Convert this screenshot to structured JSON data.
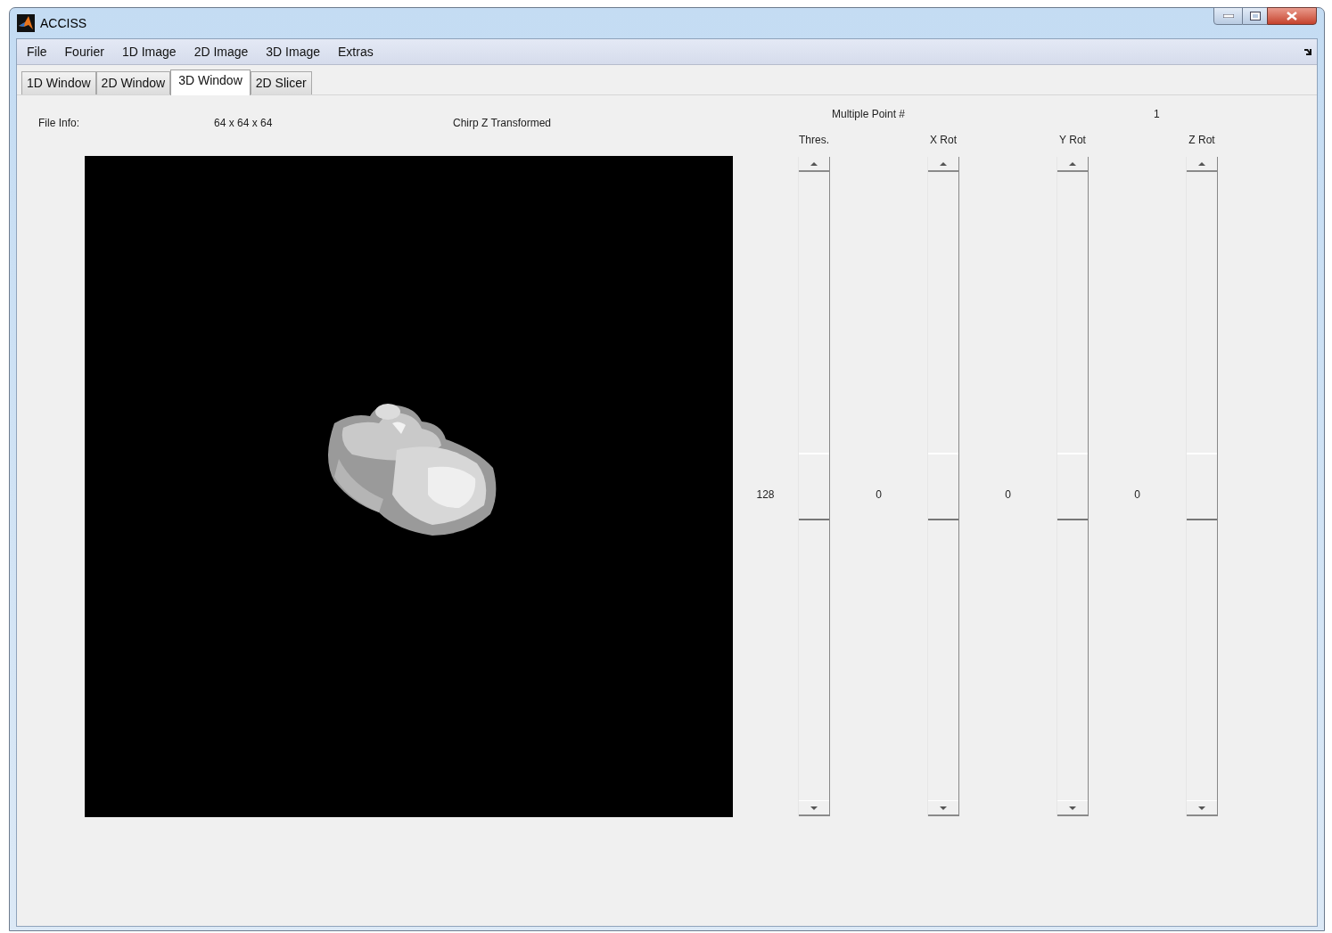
{
  "window": {
    "title": "ACCISS"
  },
  "menu": [
    "File",
    "Fourier",
    "1D Image",
    "2D Image",
    "3D Image",
    "Extras"
  ],
  "tabs": [
    {
      "label": "1D Window",
      "selected": false
    },
    {
      "label": "2D Window",
      "selected": false
    },
    {
      "label": "3D Window",
      "selected": true
    },
    {
      "label": "2D Slicer",
      "selected": false
    }
  ],
  "file_info": {
    "label": "File Info:",
    "dimensions": "64 x 64 x 64",
    "transform": "Chirp Z Transformed"
  },
  "multiple_point": {
    "label": "Multiple Point #",
    "value": "1"
  },
  "sliders": [
    {
      "label": "Thres.",
      "value": "128",
      "level": 0.5
    },
    {
      "label": "X Rot",
      "value": "0",
      "level": 0.5
    },
    {
      "label": "Y Rot",
      "value": "0",
      "level": 0.5
    },
    {
      "label": "Z Rot",
      "value": "0",
      "level": 0.5
    }
  ]
}
